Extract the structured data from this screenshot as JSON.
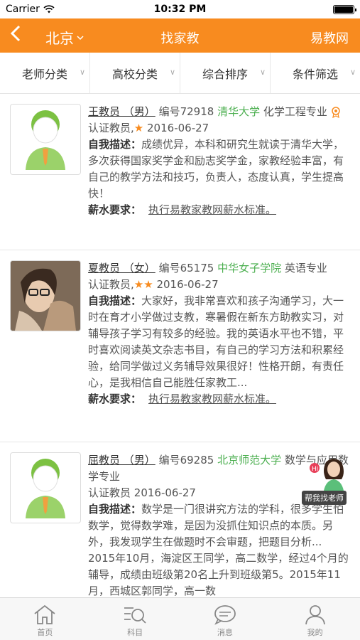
{
  "status_bar": {
    "carrier": "Carrier",
    "time": "10:32 PM"
  },
  "nav": {
    "back_icon": "chevron-left-icon",
    "city": "北京",
    "title": "找家教",
    "brand": "易教网"
  },
  "filters": [
    {
      "label": "老师分类"
    },
    {
      "label": "高校分类"
    },
    {
      "label": "综合排序"
    },
    {
      "label": "条件筛选"
    }
  ],
  "teachers": [
    {
      "name": "王教员 （男）",
      "id": "编号72918",
      "school": "清华大学",
      "major_line1": "化学工程专",
      "major_line2": "业",
      "cert": "认证教员,",
      "stars": "★",
      "date": "2016-06-27",
      "desc_label": "自我描述：",
      "desc": "成绩优异，本科和研究生就读于清华大学，多次获得国家奖学金和励志奖学金，家教经验丰富，有自己的教学方法和技巧，负责人，态度认真，学生提高快！",
      "salary_label": "薪水要求：",
      "salary": "执行易教家教网薪水标准。"
    },
    {
      "name": "夏教员 （女）",
      "id": "编号65175",
      "school": "中华女子学院",
      "major_line1": "英语专业",
      "major_line2": "",
      "cert": "认证教员,",
      "stars": "★★",
      "date": "2016-06-27",
      "desc_label": "自我描述：",
      "desc": "大家好，我非常喜欢和孩子沟通学习，大一时在育才小学做过支教，寒暑假在新东方助教实习，对辅导孩子学习有较多的经验。我的英语水平也不错，平时喜欢阅读英文杂志书目，有自己的学习方法和积累经验，给同学做过义务辅导效果很好！性格开朗，有责任心，是我相信自己能胜任家教工...",
      "salary_label": "薪水要求：",
      "salary": "执行易教家教网薪水标准。"
    },
    {
      "name": "屈教员 （男）",
      "id": "编号69285",
      "school": "北京师范大学",
      "major_line1": "数学与应",
      "major_line2": "用数学专业",
      "cert": "认证教员",
      "stars": "",
      "date": "2016-06-27",
      "desc_label": "自我描述：",
      "desc": "数学是一门很讲究方法的学科，很多学生怕数学，觉得数学难，是因为没抓住知识点的本质。另外，我发现学生在做题时不会审题，把题目分析... 2015年10月，海淀区王同学，高二数学，经过4个月的辅导，成绩由班级第20名上升到班级第5。2015年11月，西城区郭同学，高一数",
      "salary_label": "",
      "salary": ""
    }
  ],
  "help_badge": "帮我找老师",
  "tabs": [
    {
      "label": "首页",
      "icon": "home-icon"
    },
    {
      "label": "科目",
      "icon": "subject-search-icon"
    },
    {
      "label": "消息",
      "icon": "message-icon"
    },
    {
      "label": "我的",
      "icon": "profile-icon"
    }
  ],
  "colors": {
    "accent": "#f88b1f",
    "school_green": "#4caf50",
    "star": "#f88b1f"
  }
}
